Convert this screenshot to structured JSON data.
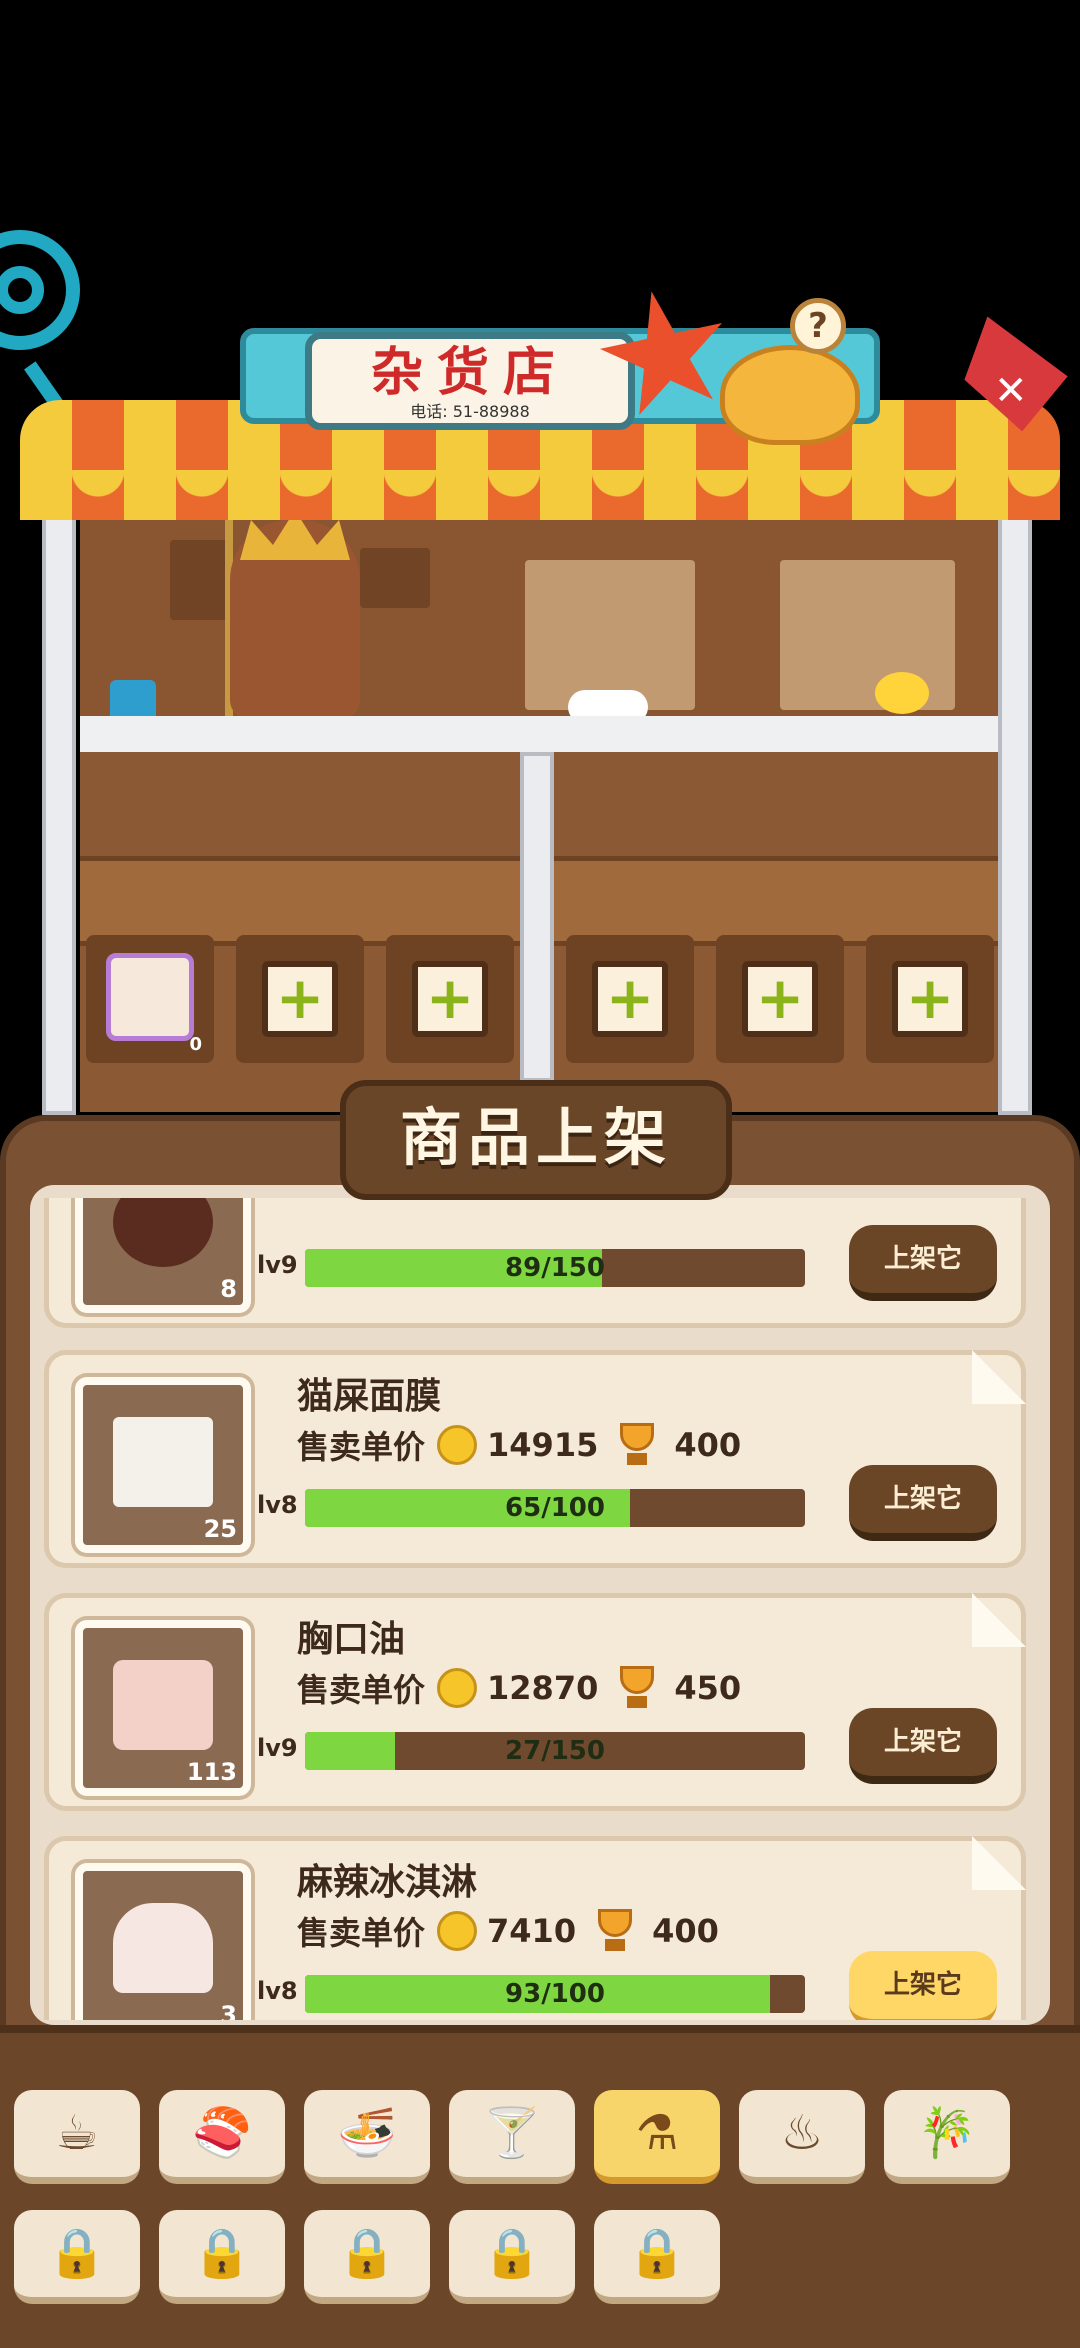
{
  "shop": {
    "title": "杂货店",
    "phone": "电话: 51-88988",
    "help_label": "?",
    "slots": [
      {
        "type": "item",
        "count": "0"
      },
      {
        "type": "empty",
        "label": "+"
      },
      {
        "type": "empty",
        "label": "+"
      },
      {
        "type": "empty",
        "label": "+"
      },
      {
        "type": "empty",
        "label": "+"
      },
      {
        "type": "empty",
        "label": "+"
      }
    ]
  },
  "panel": {
    "title": "商品上架",
    "price_label": "售卖单价",
    "items": [
      {
        "name": "",
        "count": "8",
        "level": "lv9",
        "progress_text": "89/150",
        "progress": 0.593,
        "price": "",
        "trophy": "",
        "button": "上架它",
        "button_active": false
      },
      {
        "name": "猫屎面膜",
        "count": "25",
        "level": "lv8",
        "progress_text": "65/100",
        "progress": 0.65,
        "price": "14915",
        "trophy": "400",
        "button": "上架它",
        "button_active": false
      },
      {
        "name": "胸口油",
        "count": "113",
        "level": "lv9",
        "progress_text": "27/150",
        "progress": 0.18,
        "price": "12870",
        "trophy": "450",
        "button": "上架它",
        "button_active": false
      },
      {
        "name": "麻辣冰淇淋",
        "count": "3",
        "level": "lv8",
        "progress_text": "93/100",
        "progress": 0.93,
        "price": "7410",
        "trophy": "400",
        "button": "上架它",
        "button_active": true
      }
    ]
  },
  "tabs": {
    "row1": [
      {
        "icon": "coffee-cup-icon",
        "glyph": "☕",
        "active": false
      },
      {
        "icon": "sushi-icon",
        "glyph": "🍣",
        "active": false
      },
      {
        "icon": "noodle-bowl-icon",
        "glyph": "🍜",
        "active": false
      },
      {
        "icon": "cocktail-icon",
        "glyph": "🍸",
        "active": false
      },
      {
        "icon": "flask-icon",
        "glyph": "⚗",
        "active": true
      },
      {
        "icon": "grill-icon",
        "glyph": "♨",
        "active": false
      },
      {
        "icon": "bamboo-icon",
        "glyph": "🎋",
        "active": false
      }
    ],
    "row2": [
      {
        "icon": "lock-icon",
        "glyph": "🔒"
      },
      {
        "icon": "lock-icon",
        "glyph": "🔒"
      },
      {
        "icon": "lock-icon",
        "glyph": "🔒"
      },
      {
        "icon": "lock-icon",
        "glyph": "🔒"
      },
      {
        "icon": "lock-icon",
        "glyph": "🔒"
      }
    ]
  },
  "colors": {
    "accent": "#f8d56a",
    "progress": "#7ed640",
    "panel": "#7a5233"
  }
}
